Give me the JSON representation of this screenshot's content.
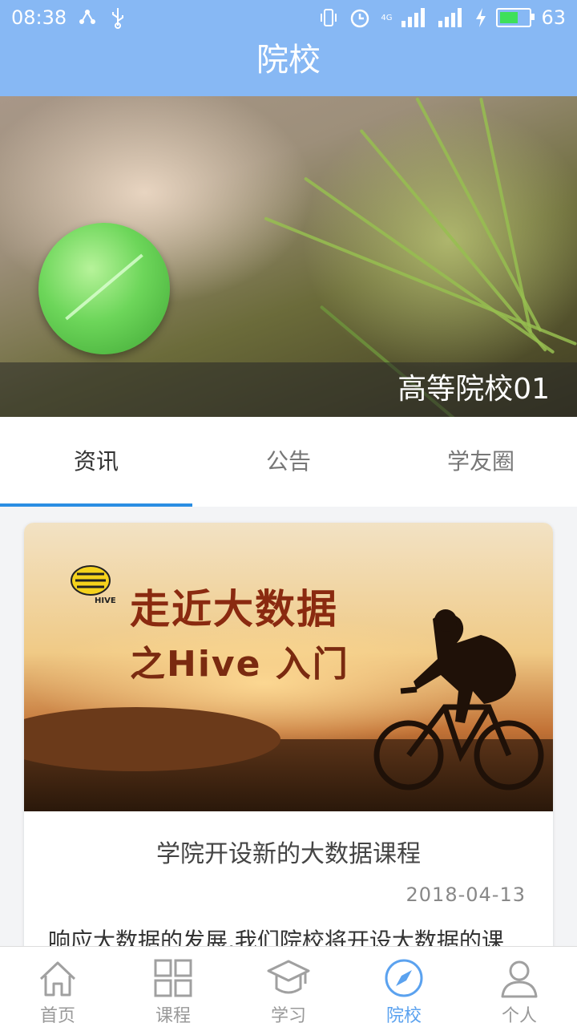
{
  "status_bar": {
    "time": "08:38",
    "network": "4G",
    "battery_percent": "63",
    "battery_level": 0.63
  },
  "header": {
    "title": "院校"
  },
  "banner": {
    "school_name": "高等院校01"
  },
  "tabs": [
    {
      "label": "资讯",
      "active": true
    },
    {
      "label": "公告",
      "active": false
    },
    {
      "label": "学友圈",
      "active": false
    }
  ],
  "news_card": {
    "image_title_line1": "走近大数据",
    "image_title_line2": "之Hive 入门",
    "image_logo_text": "HIVE",
    "title": "学院开设新的大数据课程",
    "date": "2018-04-13",
    "summary": "响应大数据的发展,我们院校将开设大数据的课"
  },
  "bottom_nav": [
    {
      "label": "首页",
      "icon": "home-icon",
      "active": false
    },
    {
      "label": "课程",
      "icon": "grid-icon",
      "active": false
    },
    {
      "label": "学习",
      "icon": "graduation-cap-icon",
      "active": false
    },
    {
      "label": "院校",
      "icon": "compass-icon",
      "active": true
    },
    {
      "label": "个人",
      "icon": "person-icon",
      "active": false
    }
  ],
  "colors": {
    "header": "#87b8f4",
    "accent": "#2a8de3",
    "nav_active": "#5ba2ef"
  }
}
